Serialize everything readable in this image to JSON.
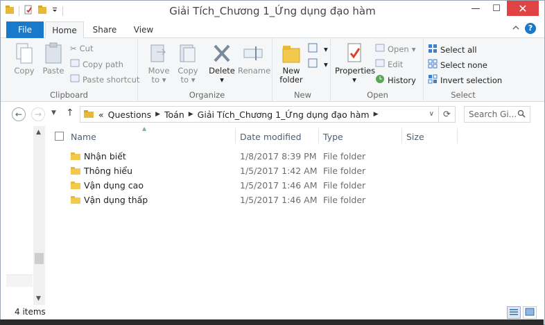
{
  "window": {
    "title": "Giải Tích_Chương 1_Ứng dụng đạo hàm",
    "minimize": "—",
    "maximize": "☐",
    "close": "✕"
  },
  "tabs": {
    "file": "File",
    "home": "Home",
    "share": "Share",
    "view": "View"
  },
  "ribbon": {
    "clipboard": {
      "label": "Clipboard",
      "copy": "Copy",
      "paste": "Paste",
      "cut": "Cut",
      "copy_path": "Copy path",
      "paste_shortcut": "Paste shortcut"
    },
    "organize": {
      "label": "Organize",
      "move_to": "Move",
      "move_to2": "to",
      "copy_to": "Copy",
      "copy_to2": "to",
      "delete": "Delete",
      "rename": "Rename"
    },
    "new": {
      "label": "New",
      "new_folder": "New",
      "new_folder2": "folder"
    },
    "open": {
      "label": "Open",
      "properties": "Properties",
      "open": "Open",
      "edit": "Edit",
      "history": "History"
    },
    "select": {
      "label": "Select",
      "select_all": "Select all",
      "select_none": "Select none",
      "invert": "Invert selection"
    }
  },
  "address": {
    "lead": "«",
    "crumbs": [
      "Questions",
      "Toán",
      "Giải Tích_Chương 1_Ứng dụng đạo hàm"
    ],
    "search_placeholder": "Search Gi..."
  },
  "columns": {
    "name": "Name",
    "date": "Date modified",
    "type": "Type",
    "size": "Size"
  },
  "rows": [
    {
      "name": "Nhận biết",
      "date": "1/8/2017 8:39 PM",
      "type": "File folder"
    },
    {
      "name": "Thông hiểu",
      "date": "1/5/2017 1:42 AM",
      "type": "File folder"
    },
    {
      "name": "Vận dụng cao",
      "date": "1/5/2017 1:46 AM",
      "type": "File folder"
    },
    {
      "name": "Vận dụng thấp",
      "date": "1/5/2017 1:46 AM",
      "type": "File folder"
    }
  ],
  "status": {
    "count": "4 items"
  },
  "colors": {
    "accent": "#1979ca",
    "close": "#e04343",
    "folder": "#e8b83a"
  }
}
